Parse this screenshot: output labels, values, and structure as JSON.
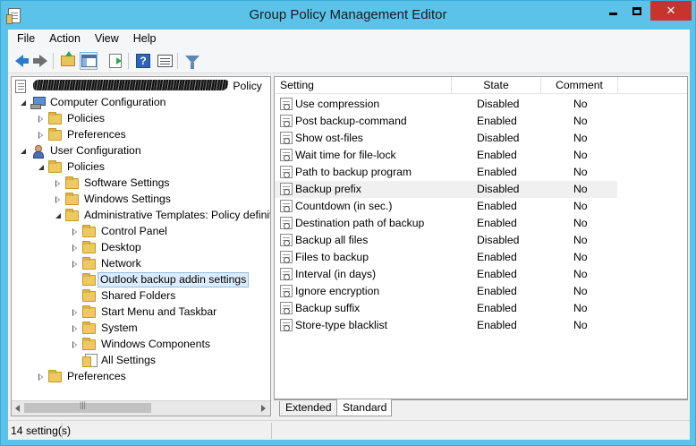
{
  "window": {
    "title": "Group Policy Management Editor"
  },
  "menu": [
    "File",
    "Action",
    "View",
    "Help"
  ],
  "toolbar": {
    "icons": [
      "back-arrow-icon",
      "forward-arrow-icon",
      "up-folder-icon",
      "show-hide-tree-icon",
      "export-list-icon",
      "help-icon",
      "properties-icon",
      "filter-icon"
    ]
  },
  "tree": {
    "root": {
      "label": " Policy",
      "redacted": true
    },
    "computer_configuration": "Computer Configuration",
    "cc_policies": "Policies",
    "cc_preferences": "Preferences",
    "user_configuration": "User Configuration",
    "uc_policies": "Policies",
    "software_settings": "Software Settings",
    "windows_settings": "Windows Settings",
    "admin_templates": "Administrative Templates: Policy definitions",
    "control_panel": "Control Panel",
    "desktop": "Desktop",
    "network": "Network",
    "outlook_backup": "Outlook backup addin settings",
    "shared_folders": "Shared Folders",
    "start_menu": "Start Menu and Taskbar",
    "system": "System",
    "windows_components": "Windows Components",
    "all_settings": "All Settings",
    "uc_preferences": "Preferences"
  },
  "list": {
    "headers": {
      "setting": "Setting",
      "state": "State",
      "comment": "Comment"
    },
    "rows": [
      {
        "setting": "Use compression",
        "state": "Disabled",
        "comment": "No"
      },
      {
        "setting": "Post backup-command",
        "state": "Enabled",
        "comment": "No"
      },
      {
        "setting": "Show ost-files",
        "state": "Disabled",
        "comment": "No"
      },
      {
        "setting": "Wait time for file-lock",
        "state": "Enabled",
        "comment": "No"
      },
      {
        "setting": "Path to backup program",
        "state": "Enabled",
        "comment": "No"
      },
      {
        "setting": "Backup prefix",
        "state": "Disabled",
        "comment": "No"
      },
      {
        "setting": "Countdown (in sec.)",
        "state": "Enabled",
        "comment": "No"
      },
      {
        "setting": "Destination path of backup",
        "state": "Enabled",
        "comment": "No"
      },
      {
        "setting": "Backup all files",
        "state": "Disabled",
        "comment": "No"
      },
      {
        "setting": "Files to backup",
        "state": "Enabled",
        "comment": "No"
      },
      {
        "setting": "Interval (in days)",
        "state": "Enabled",
        "comment": "No"
      },
      {
        "setting": "Ignore encryption",
        "state": "Enabled",
        "comment": "No"
      },
      {
        "setting": "Backup suffix",
        "state": "Enabled",
        "comment": "No"
      },
      {
        "setting": "Store-type blacklist",
        "state": "Enabled",
        "comment": "No"
      }
    ]
  },
  "tabs": {
    "extended": "Extended",
    "standard": "Standard"
  },
  "status": {
    "text": "14 setting(s)"
  },
  "colors": {
    "title_bar": "#5bc3ea",
    "close_button": "#c7342b",
    "selection": "#dcecfb"
  }
}
